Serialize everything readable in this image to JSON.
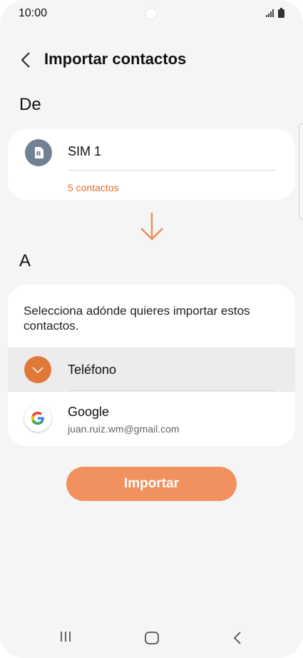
{
  "status_bar": {
    "time": "10:00",
    "icons": [
      "signal-icon",
      "battery-icon"
    ]
  },
  "header": {
    "back_icon": "chevron-left-icon",
    "title": "Importar contactos"
  },
  "source": {
    "label": "De",
    "sim": {
      "icon": "sim-card-icon",
      "name": "SIM 1",
      "count": "5 contactos"
    }
  },
  "arrow_icon": "arrow-down-icon",
  "destination": {
    "label": "A",
    "prompt": "Selecciona adónde quieres importar estos contactos.",
    "options": [
      {
        "icon": "check-icon",
        "label": "Teléfono",
        "selected": true
      },
      {
        "icon": "google-icon",
        "label": "Google",
        "account": "juan.ruiz.wm@gmail.com",
        "selected": false
      }
    ]
  },
  "actions": {
    "import_label": "Importar"
  },
  "colors": {
    "accent": "#e07030",
    "button": "#f0915f",
    "sim_avatar": "#6f8193",
    "background": "#f5f5f5"
  },
  "nav_bar": {
    "icons": [
      "recents-icon",
      "home-icon",
      "back-icon"
    ]
  }
}
